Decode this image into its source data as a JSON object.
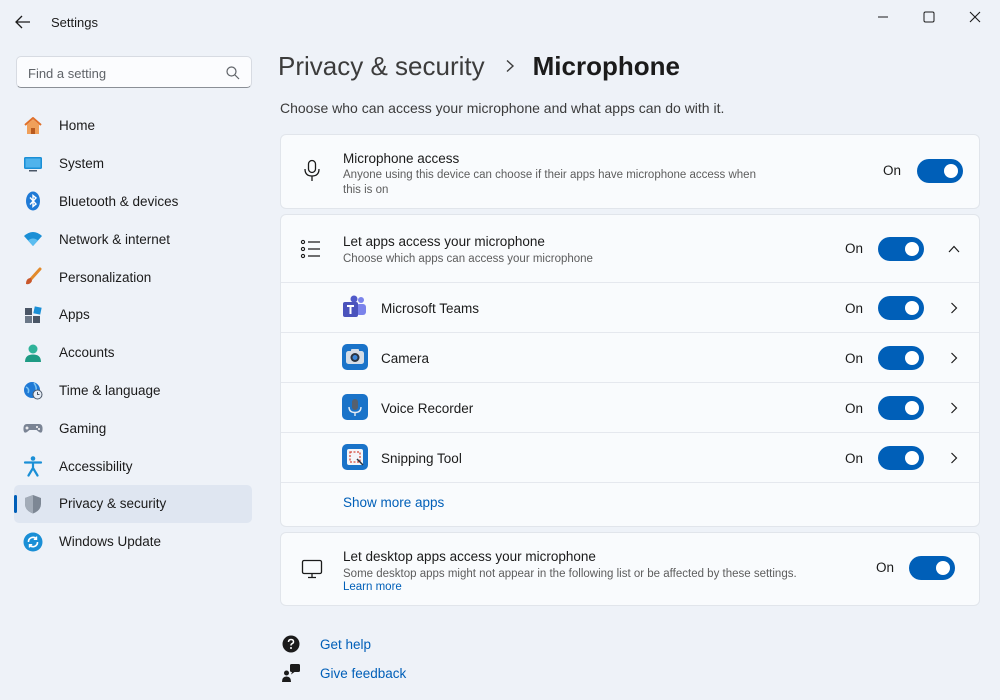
{
  "window": {
    "title": "Settings"
  },
  "search": {
    "placeholder": "Find a setting"
  },
  "sidebar": {
    "items": [
      {
        "label": "Home",
        "icon": "home-icon"
      },
      {
        "label": "System",
        "icon": "system-icon"
      },
      {
        "label": "Bluetooth & devices",
        "icon": "bluetooth-icon"
      },
      {
        "label": "Network & internet",
        "icon": "wifi-icon"
      },
      {
        "label": "Personalization",
        "icon": "brush-icon"
      },
      {
        "label": "Apps",
        "icon": "apps-icon"
      },
      {
        "label": "Accounts",
        "icon": "accounts-icon"
      },
      {
        "label": "Time & language",
        "icon": "globe-clock-icon"
      },
      {
        "label": "Gaming",
        "icon": "gamepad-icon"
      },
      {
        "label": "Accessibility",
        "icon": "accessibility-icon"
      },
      {
        "label": "Privacy & security",
        "icon": "shield-icon",
        "active": true
      },
      {
        "label": "Windows Update",
        "icon": "update-icon"
      }
    ]
  },
  "breadcrumb": {
    "parent": "Privacy & security",
    "current": "Microphone"
  },
  "page": {
    "subtitle": "Choose who can access your microphone and what apps can do with it."
  },
  "microphone_access": {
    "title": "Microphone access",
    "description": "Anyone using this device can choose if their apps have microphone access when this is on",
    "state": "On"
  },
  "apps_access": {
    "title": "Let apps access your microphone",
    "description": "Choose which apps can access your microphone",
    "state": "On",
    "apps": [
      {
        "name": "Microsoft Teams",
        "state": "On",
        "icon": "teams-icon"
      },
      {
        "name": "Camera",
        "state": "On",
        "icon": "camera-icon"
      },
      {
        "name": "Voice Recorder",
        "state": "On",
        "icon": "voice-recorder-icon"
      },
      {
        "name": "Snipping Tool",
        "state": "On",
        "icon": "snipping-tool-icon"
      }
    ],
    "show_more": "Show more apps"
  },
  "desktop_apps": {
    "title": "Let desktop apps access your microphone",
    "description": "Some desktop apps might not appear in the following list or be affected by these settings.",
    "learn_more": "Learn more",
    "state": "On"
  },
  "footer": {
    "get_help": "Get help",
    "give_feedback": "Give feedback"
  },
  "colors": {
    "accent": "#005fb8",
    "background": "#eef2f8",
    "card": "#f9fbfd"
  }
}
